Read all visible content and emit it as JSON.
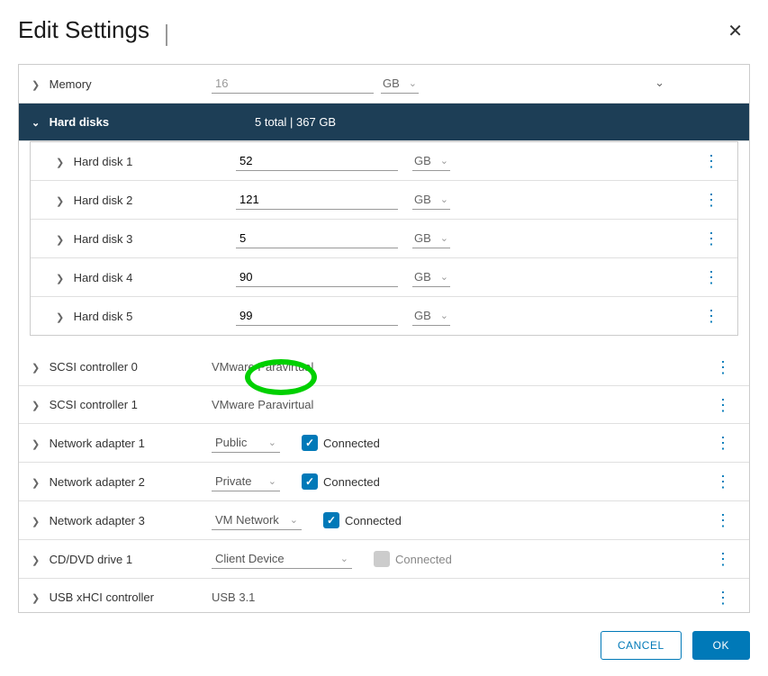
{
  "dialog": {
    "title": "Edit Settings"
  },
  "memory": {
    "label": "Memory",
    "value": "16",
    "unit": "GB"
  },
  "hard_disks_header": {
    "label": "Hard disks",
    "summary": "5 total | 367 GB"
  },
  "disks": [
    {
      "label": "Hard disk 1",
      "size": "52",
      "unit": "GB"
    },
    {
      "label": "Hard disk 2",
      "size": "121",
      "unit": "GB"
    },
    {
      "label": "Hard disk 3",
      "size": "5",
      "unit": "GB"
    },
    {
      "label": "Hard disk 4",
      "size": "90",
      "unit": "GB"
    },
    {
      "label": "Hard disk 5",
      "size": "99",
      "unit": "GB"
    }
  ],
  "scsi_controllers": [
    {
      "label": "SCSI controller 0",
      "value": "VMware Paravirtual"
    },
    {
      "label": "SCSI controller 1",
      "value": "VMware Paravirtual"
    }
  ],
  "network_adapters": [
    {
      "label": "Network adapter 1",
      "option": "Public",
      "connected_label": "Connected",
      "checked": true
    },
    {
      "label": "Network adapter 2",
      "option": "Private",
      "connected_label": "Connected",
      "checked": true
    },
    {
      "label": "Network adapter 3",
      "option": "VM Network",
      "connected_label": "Connected",
      "checked": true
    }
  ],
  "cddvd": {
    "label": "CD/DVD drive 1",
    "option": "Client Device",
    "connected_label": "Connected",
    "checked": false
  },
  "usb": {
    "label": "USB xHCI controller",
    "value": "USB 3.1"
  },
  "footer": {
    "cancel": "CANCEL",
    "ok": "OK"
  }
}
